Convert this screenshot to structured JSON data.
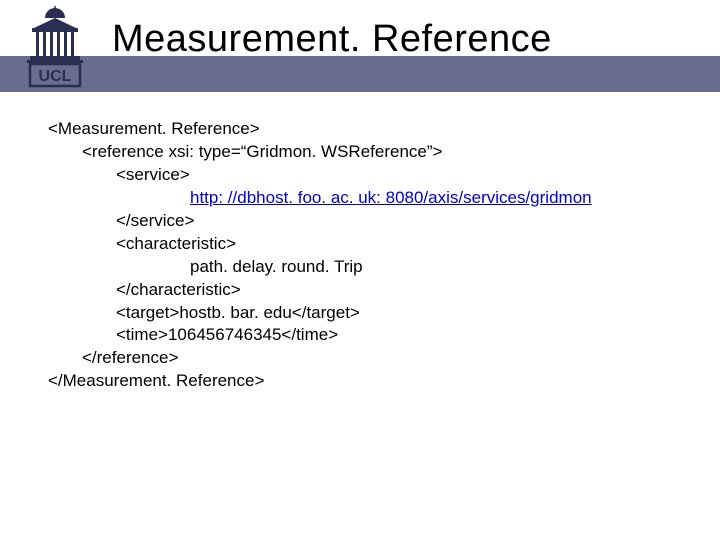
{
  "header": {
    "title": "Measurement. Reference",
    "logo_label": "UCL"
  },
  "xml": {
    "open_root": "<Measurement. Reference>",
    "ref_open": "<reference xsi: type=“Gridmon. WSReference”>",
    "service_open": "<service>",
    "service_url": "http: //dbhost. foo. ac. uk: 8080/axis/services/gridmon",
    "service_close": "</service>",
    "char_open": "<characteristic>",
    "char_value": "path. delay. round. Trip",
    "char_close": "</characteristic>",
    "target_line": "<target>hostb. bar. edu</target>",
    "time_line": "<time>106456746345</time>",
    "ref_close": "</reference>",
    "close_root": "</Measurement. Reference>"
  }
}
